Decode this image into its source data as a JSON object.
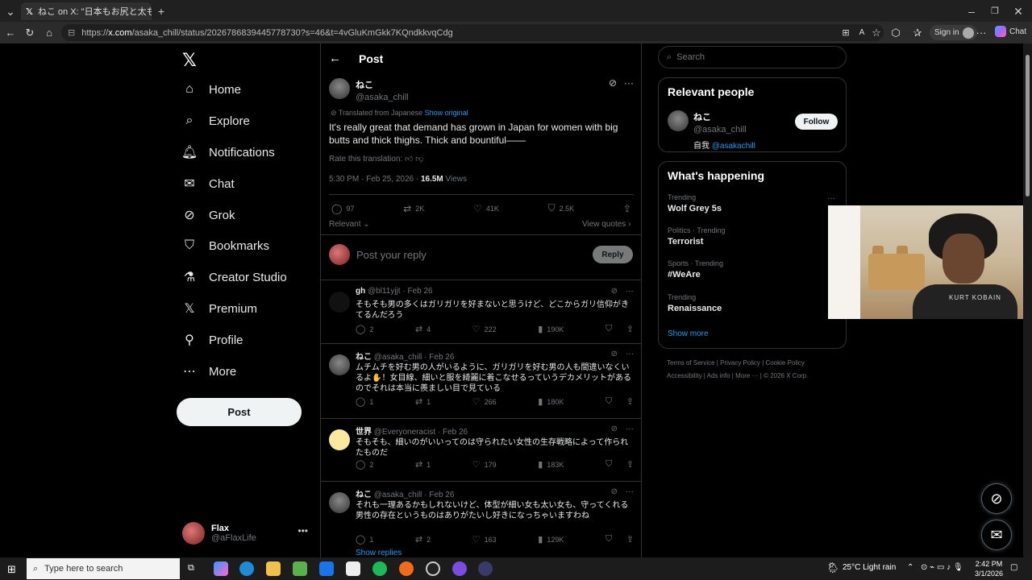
{
  "browser": {
    "tab_title": "ねこ on X: \"日本もお尻と太ももがでか",
    "url_domain": "x.com",
    "url_prefix": "https://",
    "url_path": "/asaka_chill/status/2026786839445778730?s=46&t=4vGluKmGkk7KQndkkvqCdg",
    "signin_label": "Sign in",
    "chat_label": "Chat"
  },
  "nav": {
    "items": [
      {
        "label": "Home",
        "icon": "home-icon"
      },
      {
        "label": "Explore",
        "icon": "search-icon"
      },
      {
        "label": "Notifications",
        "icon": "bell-icon"
      },
      {
        "label": "Chat",
        "icon": "mail-icon"
      },
      {
        "label": "Grok",
        "icon": "grok-icon"
      },
      {
        "label": "Bookmarks",
        "icon": "bookmark-icon"
      },
      {
        "label": "Creator Studio",
        "icon": "flask-icon"
      },
      {
        "label": "Premium",
        "icon": "x-icon"
      },
      {
        "label": "Profile",
        "icon": "person-icon"
      },
      {
        "label": "More",
        "icon": "more-circle-icon"
      }
    ],
    "post_label": "Post",
    "me": {
      "name": "Flax",
      "handle": "@aFlaxLife"
    }
  },
  "post": {
    "header": "Post",
    "author": {
      "name": "ねこ",
      "handle": "@asaka_chill"
    },
    "translated_label": "Translated from Japanese",
    "show_original": "Show original",
    "text": "It's really great that demand has grown in Japan for women with big butts and thick thighs. Thick and bountiful——",
    "rate_label": "Rate this translation:",
    "time": "5:30 PM · Feb 25, 2026 · ",
    "views_count": "16.5M",
    "views_label": " Views",
    "stats": {
      "replies": "97",
      "reposts": "2K",
      "likes": "41K",
      "bookmarks": "2.5K"
    },
    "sort_label": "Relevant",
    "view_quotes": "View quotes",
    "reply_placeholder": "Post your reply",
    "reply_button": "Reply"
  },
  "replies": [
    {
      "name": "gh",
      "handle": "@bl11yjjt",
      "date": "Feb 26",
      "text": "そもそも男の多くはガリガリを好まないと思うけど、どこからガリ信仰がきてるんだろう",
      "stats": {
        "replies": "2",
        "reposts": "4",
        "likes": "222",
        "views": "190K"
      }
    },
    {
      "name": "ねこ",
      "handle": "@asaka_chill",
      "date": "Feb 26",
      "text": "ムチムチを好む男の人がいるように、ガリガリを好む男の人も間違いなくいるよ✋！女目線、細いと服を綺麗に着こなせるっていうデカメリットがあるのでそれは本当に羨ましい目で見ている",
      "stats": {
        "replies": "1",
        "reposts": "1",
        "likes": "266",
        "views": "180K"
      }
    },
    {
      "name": "世界",
      "handle": "@Everyoneracist",
      "date": "Feb 26",
      "text": "そもそも、細いのがいいってのは守られたい女性の生存戦略によって作られたものだ",
      "stats": {
        "replies": "2",
        "reposts": "1",
        "likes": "179",
        "views": "183K"
      }
    },
    {
      "name": "ねこ",
      "handle": "@asaka_chill",
      "date": "Feb 26",
      "text": "それも一理あるかもしれないけど、体型が細い女も太い女も、守ってくれる男性の存在というものはありがたいし好きになっちゃいますわね",
      "stats": {
        "replies": "1",
        "reposts": "2",
        "likes": "163",
        "views": "129K"
      }
    }
  ],
  "show_replies": "Show replies",
  "right": {
    "search_placeholder": "Search",
    "relevant_title": "Relevant people",
    "person": {
      "name": "ねこ",
      "handle": "@asaka_chill",
      "bio_prefix": "自我 ",
      "bio_link": "@asakachill",
      "follow": "Follow"
    },
    "happening_title": "What's happening",
    "trends": [
      {
        "category": "Trending",
        "title": "Wolf Grey 5s"
      },
      {
        "category": "Politics · Trending",
        "title": "Terrorist"
      },
      {
        "category": "Sports · Trending",
        "title": "#WeAre"
      },
      {
        "category": "Trending",
        "title": "Renaissance"
      }
    ],
    "show_more": "Show more",
    "footer": [
      "Terms of Service",
      "Privacy Policy",
      "Cookie Policy",
      "Accessibility",
      "Ads info",
      "More ···",
      "© 2026 X Corp."
    ]
  },
  "webcam": {
    "shirt_text": "KURT KOBAIN"
  },
  "taskbar": {
    "search_placeholder": "Type here to search",
    "weather": "25°C  Light rain",
    "time": "2:42 PM",
    "date": "3/1/2026"
  },
  "colors": {
    "accent": "#1d9bf0",
    "background": "#000000",
    "border": "#2f3336",
    "muted": "#71767b"
  }
}
